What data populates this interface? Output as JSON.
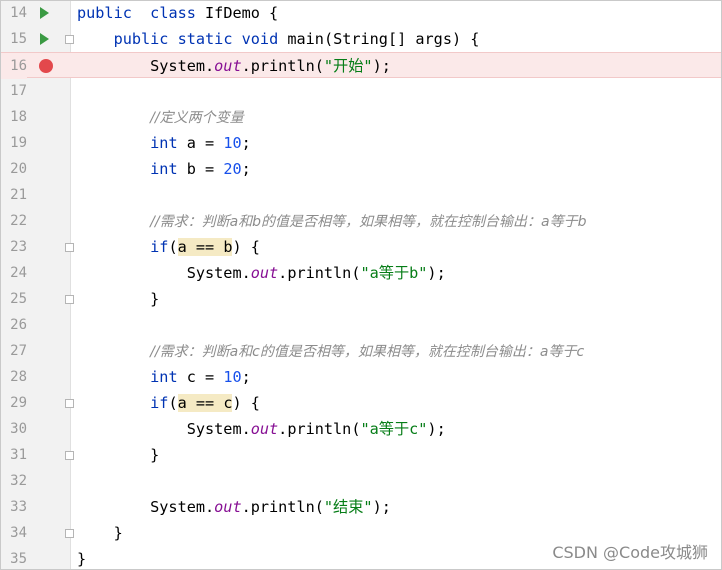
{
  "lines": [
    {
      "num": "14",
      "tokens": [
        [
          "kw",
          "public"
        ],
        [
          "",
          "  "
        ],
        [
          "kw",
          "class"
        ],
        [
          "",
          " IfDemo {"
        ]
      ]
    },
    {
      "num": "15",
      "tokens": [
        [
          "",
          "    "
        ],
        [
          "kw",
          "public"
        ],
        [
          "",
          " "
        ],
        [
          "kw",
          "static"
        ],
        [
          "",
          " "
        ],
        [
          "kw",
          "void"
        ],
        [
          "",
          " "
        ],
        [
          "",
          "main(String[] args) {"
        ]
      ]
    },
    {
      "num": "16",
      "tokens": [
        [
          "",
          "        System."
        ],
        [
          "field",
          "out"
        ],
        [
          "",
          ".println("
        ],
        [
          "str",
          "\"开始\""
        ],
        [
          "",
          ");"
        ]
      ]
    },
    {
      "num": "17",
      "tokens": []
    },
    {
      "num": "18",
      "tokens": [
        [
          "",
          "        "
        ],
        [
          "cmt",
          "//定义两个变量"
        ]
      ]
    },
    {
      "num": "19",
      "tokens": [
        [
          "",
          "        "
        ],
        [
          "kw",
          "int"
        ],
        [
          "",
          " a = "
        ],
        [
          "num",
          "10"
        ],
        [
          "",
          ";"
        ]
      ]
    },
    {
      "num": "20",
      "tokens": [
        [
          "",
          "        "
        ],
        [
          "kw",
          "int"
        ],
        [
          "",
          " b = "
        ],
        [
          "num",
          "20"
        ],
        [
          "",
          ";"
        ]
      ]
    },
    {
      "num": "21",
      "tokens": []
    },
    {
      "num": "22",
      "tokens": [
        [
          "",
          "        "
        ],
        [
          "cmt",
          "//需求：判断a和b的值是否相等，如果相等，就在控制台输出：a等于b"
        ]
      ]
    },
    {
      "num": "23",
      "tokens": [
        [
          "",
          "        "
        ],
        [
          "kw",
          "if"
        ],
        [
          "",
          "("
        ],
        [
          "hi",
          "a == b"
        ],
        [
          "",
          ") {"
        ]
      ]
    },
    {
      "num": "24",
      "tokens": [
        [
          "",
          "            System."
        ],
        [
          "field",
          "out"
        ],
        [
          "",
          ".println("
        ],
        [
          "str",
          "\"a等于b\""
        ],
        [
          "",
          ");"
        ]
      ]
    },
    {
      "num": "25",
      "tokens": [
        [
          "",
          "        }"
        ]
      ]
    },
    {
      "num": "26",
      "tokens": []
    },
    {
      "num": "27",
      "tokens": [
        [
          "",
          "        "
        ],
        [
          "cmt",
          "//需求：判断a和c的值是否相等，如果相等，就在控制台输出：a等于c"
        ]
      ]
    },
    {
      "num": "28",
      "tokens": [
        [
          "",
          "        "
        ],
        [
          "kw",
          "int"
        ],
        [
          "",
          " c = "
        ],
        [
          "num",
          "10"
        ],
        [
          "",
          ";"
        ]
      ]
    },
    {
      "num": "29",
      "tokens": [
        [
          "",
          "        "
        ],
        [
          "kw",
          "if"
        ],
        [
          "",
          "("
        ],
        [
          "hi",
          "a == c"
        ],
        [
          "",
          ") {"
        ]
      ]
    },
    {
      "num": "30",
      "tokens": [
        [
          "",
          "            System."
        ],
        [
          "field",
          "out"
        ],
        [
          "",
          ".println("
        ],
        [
          "str",
          "\"a等于c\""
        ],
        [
          "",
          ");"
        ]
      ]
    },
    {
      "num": "31",
      "tokens": [
        [
          "",
          "        }"
        ]
      ]
    },
    {
      "num": "32",
      "tokens": []
    },
    {
      "num": "33",
      "tokens": [
        [
          "",
          "        System."
        ],
        [
          "field",
          "out"
        ],
        [
          "",
          ".println("
        ],
        [
          "str",
          "\"结束\""
        ],
        [
          "",
          ");"
        ]
      ]
    },
    {
      "num": "34",
      "tokens": [
        [
          "",
          "    }"
        ]
      ]
    },
    {
      "num": "35",
      "tokens": [
        [
          "",
          "}"
        ]
      ]
    }
  ],
  "gutter_icons": {
    "14": "run-icon",
    "15": "run-icon",
    "16": "breakpoint-icon"
  },
  "fold_icons": [
    "15",
    "23",
    "25",
    "29",
    "31",
    "34"
  ],
  "highlighted_line": "16",
  "watermark": "CSDN @Code攻城狮"
}
